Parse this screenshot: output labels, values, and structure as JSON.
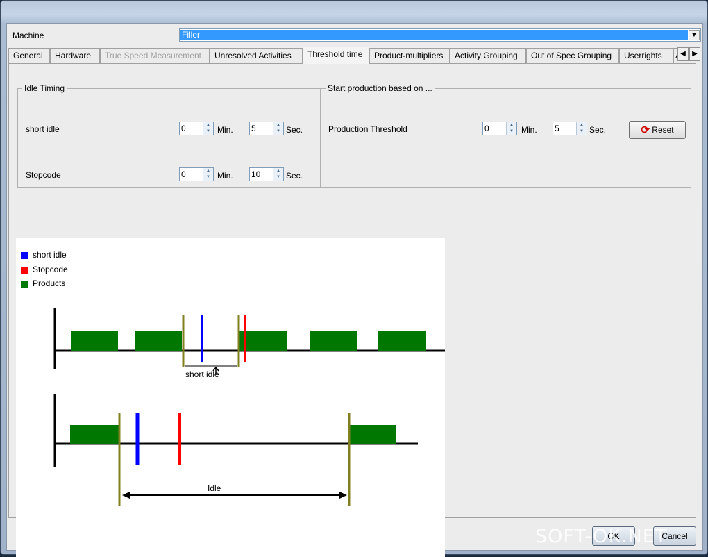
{
  "form": {
    "machine_label": "Machine",
    "machine_value": "Filler",
    "tabs": [
      {
        "label": "General"
      },
      {
        "label": "Hardware"
      },
      {
        "label": "True Speed Measurement"
      },
      {
        "label": "Unresolved Activities"
      },
      {
        "label": "Threshold time"
      },
      {
        "label": "Product-multipliers"
      },
      {
        "label": "Activity Grouping"
      },
      {
        "label": "Out of Spec Grouping"
      },
      {
        "label": "Userrights"
      },
      {
        "label": "A"
      }
    ],
    "active_tab": "Threshold time",
    "disabled_tab": "True Speed Measurement"
  },
  "idle_timing": {
    "title": "Idle Timing",
    "short_idle_label": "short idle",
    "short_idle_min": "0",
    "short_idle_sec": "5",
    "stopcode_label": "Stopcode",
    "stopcode_min": "0",
    "stopcode_sec": "10",
    "min_unit": "Min.",
    "sec_unit": "Sec."
  },
  "start_production": {
    "title": "Start production based on ...",
    "threshold_label": "Production Threshold",
    "threshold_min": "0",
    "threshold_sec": "5",
    "reset_label": "Reset"
  },
  "diagram": {
    "legend": [
      {
        "label": "short idle",
        "color": "#0000ff"
      },
      {
        "label": "Stopcode",
        "color": "#ff0000"
      },
      {
        "label": "Products",
        "color": "#007700"
      }
    ],
    "top_annotation": "short idle",
    "bottom_annotation": "Idle",
    "colors": {
      "boundary": "#808020",
      "product": "#007700",
      "short_idle": "#0000ff",
      "stopcode": "#ff0000"
    }
  },
  "footer": {
    "ok_label": "OK",
    "cancel_label": "Cancel"
  },
  "watermark": "SOFT-OK.NET"
}
